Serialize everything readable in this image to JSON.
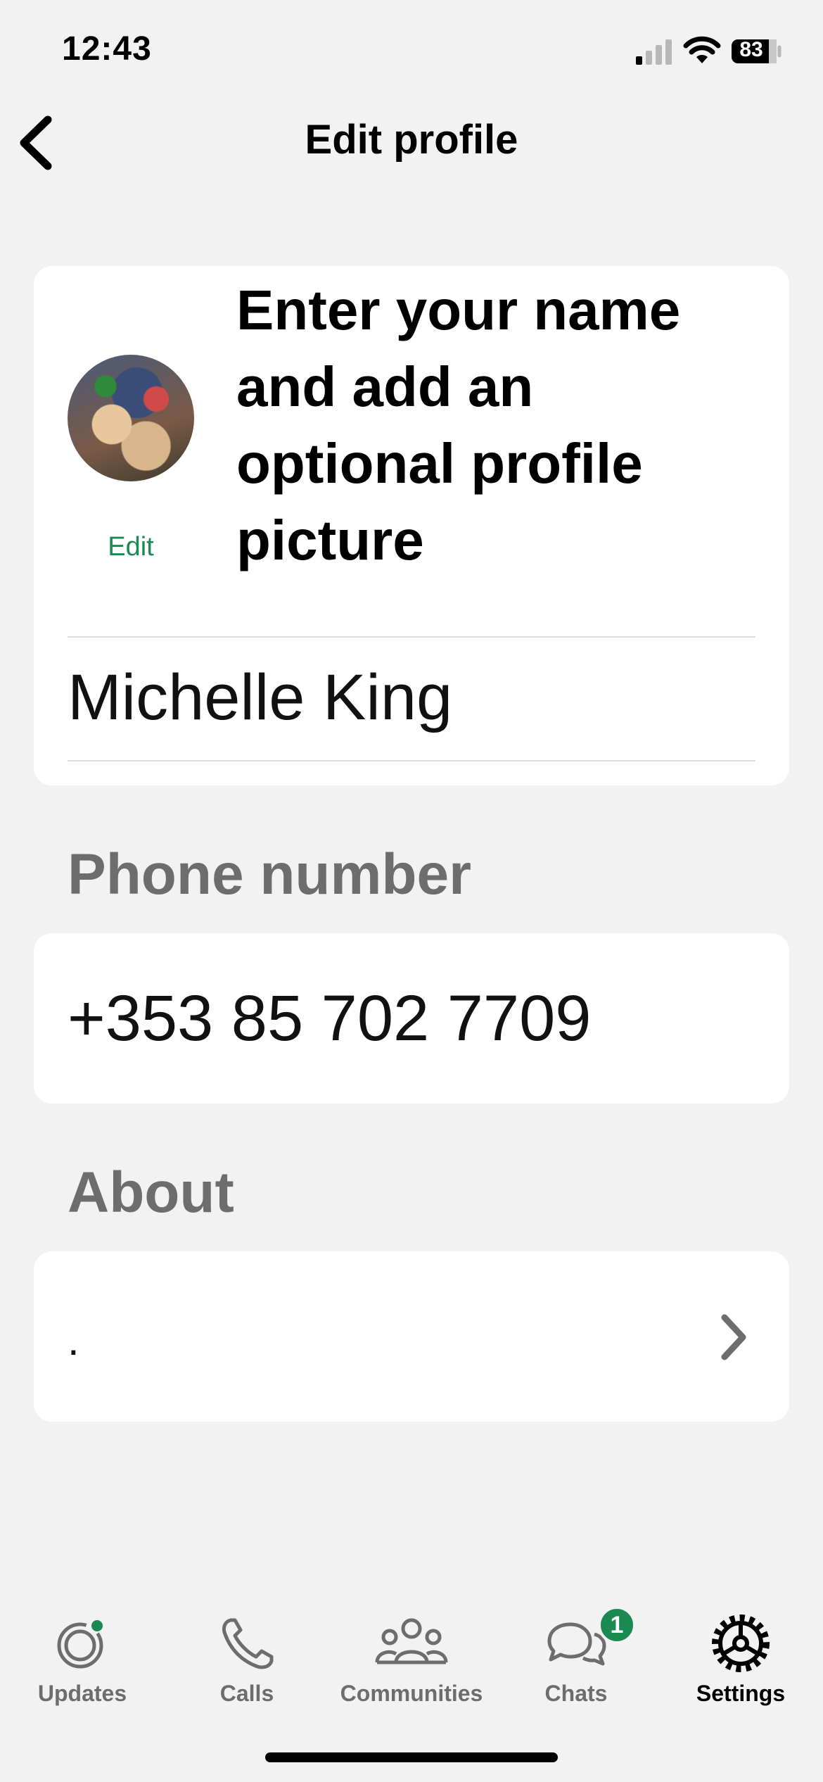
{
  "status_bar": {
    "time": "12:43",
    "battery": "83",
    "icons": [
      "cellular-signal-icon",
      "wifi-icon",
      "battery-icon"
    ]
  },
  "nav": {
    "title": "Edit profile",
    "back_icon": "chevron-left-icon"
  },
  "profile": {
    "avatar_edit_label": "Edit",
    "instruction": "Enter your name and add an optional profile picture",
    "name": "Michelle King"
  },
  "phone": {
    "header": "Phone number",
    "value": "+353 85 702 7709"
  },
  "about": {
    "header": "About",
    "value": "."
  },
  "tabbar": {
    "tabs": [
      {
        "label": "Updates",
        "icon": "updates-icon",
        "active": false
      },
      {
        "label": "Calls",
        "icon": "phone-icon",
        "active": false
      },
      {
        "label": "Communities",
        "icon": "communities-icon",
        "active": false
      },
      {
        "label": "Chats",
        "icon": "chats-icon",
        "active": false,
        "badge": "1"
      },
      {
        "label": "Settings",
        "icon": "settings-gear-icon",
        "active": true
      }
    ]
  },
  "colors": {
    "accent_green": "#1a8a52",
    "background": "#f2f2f2",
    "card": "#ffffff",
    "secondary_text": "#6d6d6d"
  }
}
